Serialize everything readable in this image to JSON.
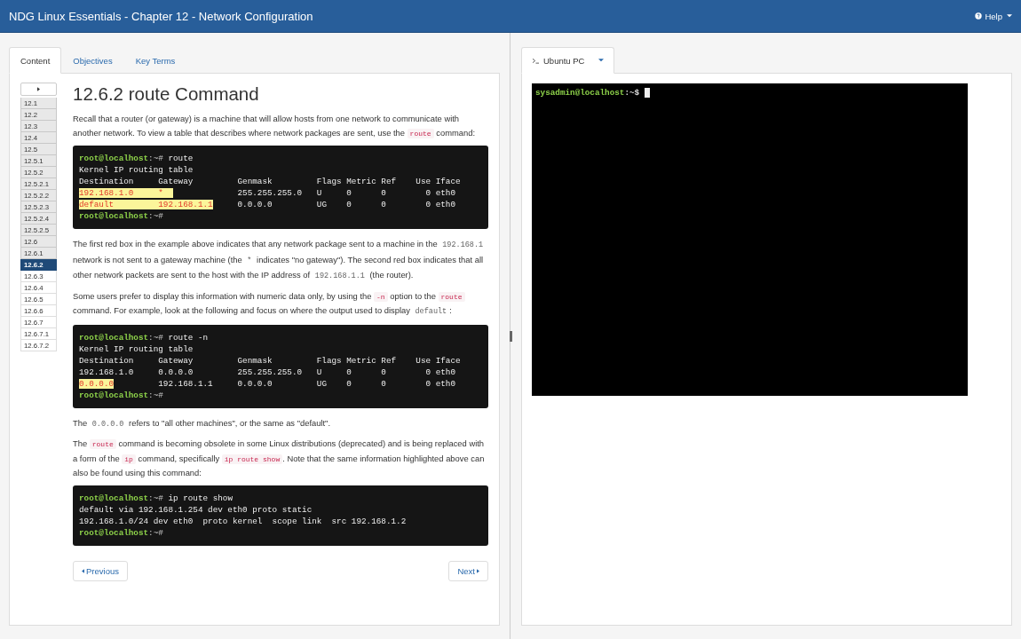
{
  "header": {
    "title": "NDG Linux Essentials - Chapter 12 - Network Configuration",
    "help": "Help"
  },
  "left": {
    "tabs": [
      {
        "label": "Content",
        "selected": true
      },
      {
        "label": "Objectives",
        "selected": false
      },
      {
        "label": "Key Terms",
        "selected": false
      }
    ],
    "nav": [
      {
        "label": "12.1",
        "visited": true,
        "selected": false
      },
      {
        "label": "12.2",
        "visited": true,
        "selected": false
      },
      {
        "label": "12.3",
        "visited": true,
        "selected": false
      },
      {
        "label": "12.4",
        "visited": true,
        "selected": false
      },
      {
        "label": "12.5",
        "visited": true,
        "selected": false
      },
      {
        "label": "12.5.1",
        "visited": true,
        "selected": false
      },
      {
        "label": "12.5.2",
        "visited": true,
        "selected": false
      },
      {
        "label": "12.5.2.1",
        "visited": true,
        "selected": false
      },
      {
        "label": "12.5.2.2",
        "visited": true,
        "selected": false
      },
      {
        "label": "12.5.2.3",
        "visited": true,
        "selected": false
      },
      {
        "label": "12.5.2.4",
        "visited": true,
        "selected": false
      },
      {
        "label": "12.5.2.5",
        "visited": true,
        "selected": false
      },
      {
        "label": "12.6",
        "visited": true,
        "selected": false
      },
      {
        "label": "12.6.1",
        "visited": true,
        "selected": false
      },
      {
        "label": "12.6.2",
        "visited": true,
        "selected": true
      },
      {
        "label": "12.6.3",
        "visited": false,
        "selected": false
      },
      {
        "label": "12.6.4",
        "visited": false,
        "selected": false
      },
      {
        "label": "12.6.5",
        "visited": false,
        "selected": false
      },
      {
        "label": "12.6.6",
        "visited": false,
        "selected": false
      },
      {
        "label": "12.6.7",
        "visited": false,
        "selected": false
      },
      {
        "label": "12.6.7.1",
        "visited": false,
        "selected": false
      },
      {
        "label": "12.6.7.2",
        "visited": false,
        "selected": false
      }
    ],
    "heading": "12.6.2 route Command",
    "blocks": [
      {
        "kind": "para",
        "segments": [
          {
            "kind": "text",
            "text": "Recall that a router (or gateway) is a machine that will allow hosts from one network to communicate with another network. To view a table that describes where network packages are sent, use the "
          },
          {
            "kind": "code",
            "text": "route"
          },
          {
            "kind": "text",
            "text": " command:"
          }
        ]
      },
      {
        "kind": "terminal",
        "lines": [
          [
            {
              "kind": "user",
              "text": "root@localhost"
            },
            {
              "kind": "sep",
              "text": ":~#"
            },
            {
              "kind": "text",
              "text": " route"
            }
          ],
          [
            {
              "kind": "text",
              "text": "Kernel IP routing table"
            }
          ],
          [
            {
              "kind": "text",
              "text": "Destination     Gateway         Genmask         Flags Metric Ref    Use Iface"
            }
          ],
          [
            {
              "kind": "mark",
              "text": "192.168.1.0     *  "
            },
            {
              "kind": "text",
              "text": "             255.255.255.0   U     0      0        0 eth0"
            }
          ],
          [
            {
              "kind": "mark",
              "text": "default         192.168.1.1"
            },
            {
              "kind": "text",
              "text": "     0.0.0.0         UG    0      0        0 eth0"
            }
          ],
          [
            {
              "kind": "user",
              "text": "root@localhost"
            },
            {
              "kind": "sep",
              "text": ":~#"
            }
          ]
        ]
      },
      {
        "kind": "para",
        "segments": [
          {
            "kind": "text",
            "text": "The first red box in the example above indicates that any network package sent to a machine in the "
          },
          {
            "kind": "mono",
            "text": "192.168.1"
          },
          {
            "kind": "text",
            "text": " network is not sent to a gateway machine (the "
          },
          {
            "kind": "mono",
            "text": "*"
          },
          {
            "kind": "text",
            "text": " indicates \"no gateway\"). The second red box indicates that all other network packets are sent to the host with the IP address of "
          },
          {
            "kind": "mono",
            "text": "192.168.1.1"
          },
          {
            "kind": "text",
            "text": " (the router)."
          }
        ]
      },
      {
        "kind": "para",
        "segments": [
          {
            "kind": "text",
            "text": "Some users prefer to display this information with numeric data only, by using the "
          },
          {
            "kind": "code",
            "text": "-n"
          },
          {
            "kind": "text",
            "text": " option to the "
          },
          {
            "kind": "code",
            "text": "route"
          },
          {
            "kind": "text",
            "text": " command. For example, look at the following and focus on where the output used to display "
          },
          {
            "kind": "mono",
            "text": "default"
          },
          {
            "kind": "text",
            "text": ":"
          }
        ]
      },
      {
        "kind": "terminal",
        "lines": [
          [
            {
              "kind": "user",
              "text": "root@localhost"
            },
            {
              "kind": "sep",
              "text": ":~#"
            },
            {
              "kind": "text",
              "text": " route -n"
            }
          ],
          [
            {
              "kind": "text",
              "text": "Kernel IP routing table"
            }
          ],
          [
            {
              "kind": "text",
              "text": "Destination     Gateway         Genmask         Flags Metric Ref    Use Iface"
            }
          ],
          [
            {
              "kind": "text",
              "text": "192.168.1.0     0.0.0.0         255.255.255.0   U     0      0        0 eth0"
            }
          ],
          [
            {
              "kind": "mark",
              "text": "0.0.0.0"
            },
            {
              "kind": "text",
              "text": "         192.168.1.1     0.0.0.0         UG    0      0        0 eth0"
            }
          ],
          [
            {
              "kind": "user",
              "text": "root@localhost"
            },
            {
              "kind": "sep",
              "text": ":~#"
            }
          ]
        ]
      },
      {
        "kind": "para",
        "segments": [
          {
            "kind": "text",
            "text": "The "
          },
          {
            "kind": "mono",
            "text": "0.0.0.0"
          },
          {
            "kind": "text",
            "text": " refers to \"all other machines\", or the same as \"default\"."
          }
        ]
      },
      {
        "kind": "para",
        "segments": [
          {
            "kind": "text",
            "text": "The "
          },
          {
            "kind": "code",
            "text": "route"
          },
          {
            "kind": "text",
            "text": " command is becoming obsolete in some Linux distributions (deprecated) and is being replaced with a form of the "
          },
          {
            "kind": "code",
            "text": "ip"
          },
          {
            "kind": "text",
            "text": " command, specifically "
          },
          {
            "kind": "code",
            "text": "ip route show"
          },
          {
            "kind": "text",
            "text": ". Note that the same information highlighted above can also be found using this command:"
          }
        ]
      },
      {
        "kind": "terminal",
        "lines": [
          [
            {
              "kind": "user",
              "text": "root@localhost"
            },
            {
              "kind": "sep",
              "text": ":~#"
            },
            {
              "kind": "text",
              "text": " ip route show"
            }
          ],
          [
            {
              "kind": "text",
              "text": "default via 192.168.1.254 dev eth0 proto static"
            }
          ],
          [
            {
              "kind": "text",
              "text": "192.168.1.0/24 dev eth0  proto kernel  scope link  src 192.168.1.2"
            }
          ],
          [
            {
              "kind": "user",
              "text": "root@localhost"
            },
            {
              "kind": "sep",
              "text": ":~#"
            }
          ]
        ]
      }
    ],
    "prev": "Previous",
    "next": "Next"
  },
  "right": {
    "tab": "Ubuntu PC",
    "terminal": {
      "user": "sysadmin@localhost",
      "prompt": ":~$"
    }
  }
}
